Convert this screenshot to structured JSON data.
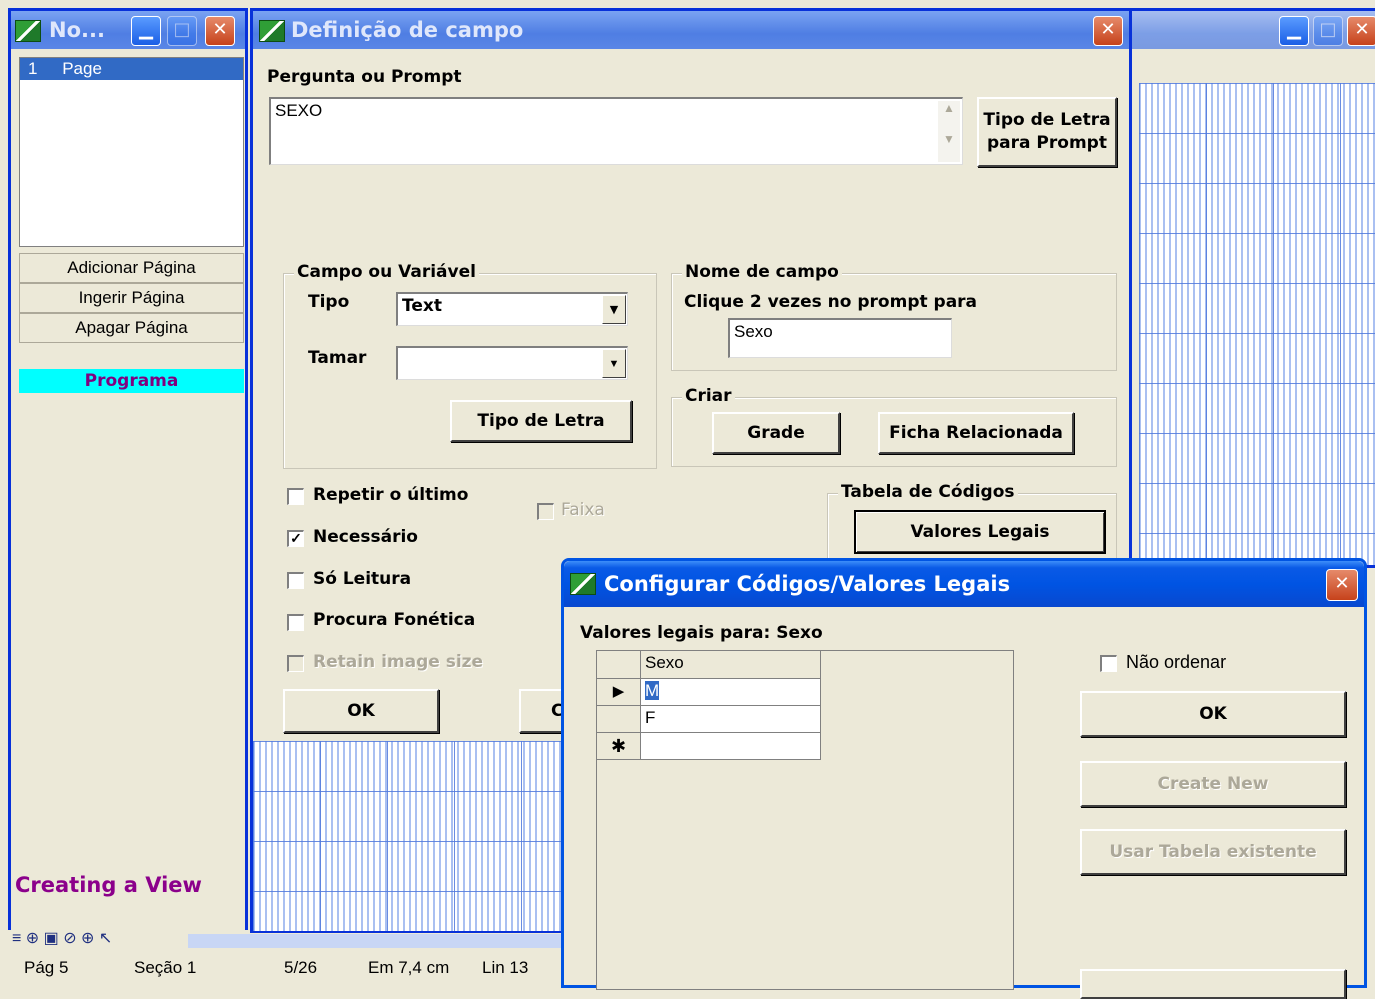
{
  "left_window": {
    "title": "No...",
    "pages": [
      {
        "num": "1",
        "label": "Page"
      }
    ],
    "buttons": {
      "add": "Adicionar Página",
      "insert": "Ingerir Página",
      "delete": "Apagar Página"
    },
    "program_label": "Programa",
    "creating_view": "Creating a View"
  },
  "field_dialog": {
    "title": "Definição de campo",
    "prompt_label": "Pergunta ou Prompt",
    "prompt_value": "SEXO",
    "font_prompt_button": [
      "Tipo de Letra",
      "para Prompt"
    ],
    "var_group": {
      "title": "Campo ou Variável",
      "type_label": "Tipo",
      "type_value": "Text",
      "size_label": "Tamar",
      "size_value": "",
      "font_button": "Tipo de Letra"
    },
    "name_group": {
      "title": "Nome de campo",
      "hint": "Clique 2 vezes no prompt para",
      "value": "Sexo"
    },
    "create_group": {
      "title": "Criar",
      "grid_button": "Grade",
      "related_button": "Ficha Relacionada"
    },
    "codes_group": {
      "title": "Tabela de Códigos",
      "legal_button": "Valores Legais"
    },
    "checkboxes": {
      "repeat": {
        "label": "Repetir o último",
        "checked": false
      },
      "required": {
        "label": "Necessário",
        "checked": true
      },
      "readonly": {
        "label": "Só Leitura",
        "checked": false
      },
      "phonetic": {
        "label": "Procura Fonética",
        "checked": false
      },
      "retain": {
        "label": "Retain image size",
        "checked": false
      },
      "range": {
        "label": "Faixa",
        "checked": false
      }
    },
    "ok_button": "OK",
    "cancel_partial": "C"
  },
  "codes_dialog": {
    "title": "Configurar Códigos/Valores Legais",
    "legal_for_label": "Valores legais para:",
    "legal_for_value": "Sexo",
    "column_header": "Sexo",
    "rows": [
      {
        "marker": "▶",
        "value": "M"
      },
      {
        "marker": "",
        "value": "F"
      },
      {
        "marker": "✱",
        "value": ""
      }
    ],
    "no_sort_label": "Não ordenar",
    "ok_button": "OK",
    "create_new_button": "Create New",
    "use_existing_button": "Usar Tabela existente"
  },
  "status_bar": {
    "page": "Pág 5",
    "section": "Seção 1",
    "fraction": "5/26",
    "position": "Em 7,4 cm",
    "line": "Lin 13"
  }
}
